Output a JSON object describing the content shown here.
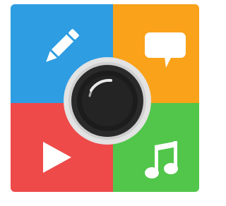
{
  "app_icon": {
    "colors": {
      "top_left": "#2e9de2",
      "top_right": "#f9a21a",
      "bottom_left": "#ee4a4a",
      "bottom_right": "#51c64a",
      "lens_ring": "#e3e3e3",
      "lens_body": "#1c1c1c",
      "glyph": "#ffffff"
    },
    "icons": {
      "top_left": "pencil-icon",
      "top_right": "speech-bubble-icon",
      "bottom_left": "play-icon",
      "bottom_right": "music-note-icon",
      "center": "camera-lens-icon"
    }
  }
}
